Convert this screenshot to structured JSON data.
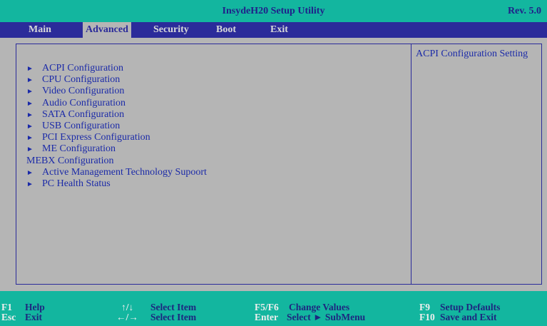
{
  "title": "InsydeH20 Setup Utility",
  "revision": "Rev. 5.0",
  "menu": [
    {
      "label": "Main"
    },
    {
      "label": "Advanced"
    },
    {
      "label": "Security"
    },
    {
      "label": "Boot"
    },
    {
      "label": "Exit"
    }
  ],
  "active_menu": "Advanced",
  "items": [
    {
      "label": "ACPI Configuration",
      "arrow": "►"
    },
    {
      "label": "CPU Configuration",
      "arrow": "►"
    },
    {
      "label": "Video Configuration",
      "arrow": "►"
    },
    {
      "label": "Audio Configuration",
      "arrow": "►"
    },
    {
      "label": "SATA Configuration",
      "arrow": "►"
    },
    {
      "label": "USB Configuration",
      "arrow": "►"
    },
    {
      "label": "PCI Express Configuration",
      "arrow": "►"
    },
    {
      "label": "ME Configuration",
      "arrow": "►"
    },
    {
      "label": "MEBX Configuration",
      "arrow": ""
    },
    {
      "label": "Active Management Technology Supoort",
      "arrow": "►"
    },
    {
      "label": "PC Health Status",
      "arrow": "►"
    }
  ],
  "help_text": "ACPI Configuration Setting",
  "footer": {
    "f1_key": "F1",
    "f1_desc": "Help",
    "esc_key": "Esc",
    "esc_desc": "Exit",
    "updown_key": "↑/↓",
    "updown_desc": "Select Item",
    "leftright_key": "←/→",
    "leftright_desc": "Select Item",
    "f5f6_key": "F5/F6",
    "f5f6_desc": "Change Values",
    "enter_key": "Enter",
    "enter_desc": "Select ► SubMenu",
    "f9_key": "F9",
    "f9_desc": "Setup Defaults",
    "f10_key": "F10",
    "f10_desc": "Save and Exit"
  },
  "colors": {
    "title_bar": "#13b69f",
    "menu_bar": "#2b2b9a",
    "panel": "#b5b5b5",
    "item_text": "#1b2aa8",
    "key_text": "#eeeeee"
  }
}
